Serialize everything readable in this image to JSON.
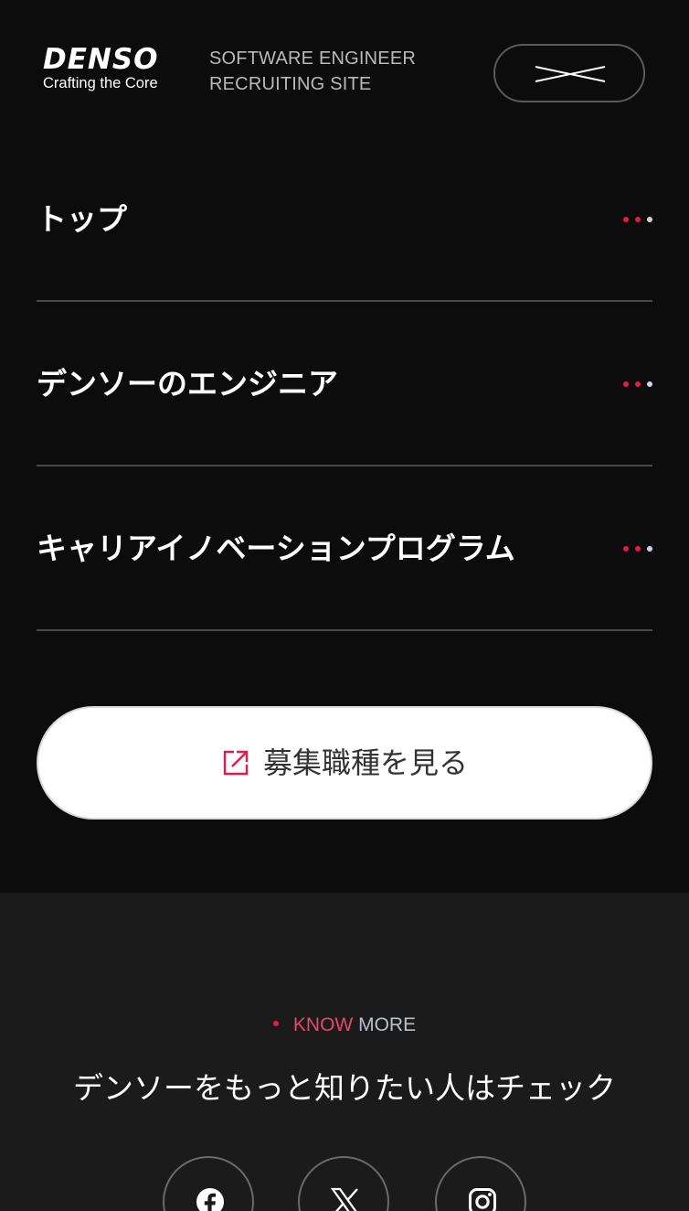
{
  "header": {
    "logo_word": "DENSO",
    "logo_tagline": "Crafting the Core",
    "site_title_line1": "SOFTWARE ENGINEER",
    "site_title_line2": "RECRUITING SITE",
    "close_icon": "close-icon"
  },
  "nav": {
    "items": [
      {
        "label": "トップ"
      },
      {
        "label": "デンソーのエンジニア"
      },
      {
        "label": "キャリアイノベーションプログラム"
      }
    ]
  },
  "cta": {
    "label": "募集職種を見る",
    "icon": "external-link-icon"
  },
  "footer": {
    "know_part1": "KNOW",
    "know_part2": "MORE",
    "check_text": "デンソーをもっと知りたい人はチェック",
    "sns": [
      {
        "icon": "facebook-icon"
      },
      {
        "icon": "x-icon"
      },
      {
        "icon": "instagram-icon"
      }
    ]
  },
  "colors": {
    "background": "#0c0c0c",
    "footer_background": "#1b1b1b",
    "accent": "#e6194b",
    "text": "#ffffff",
    "muted_text": "#b9b9b9"
  }
}
